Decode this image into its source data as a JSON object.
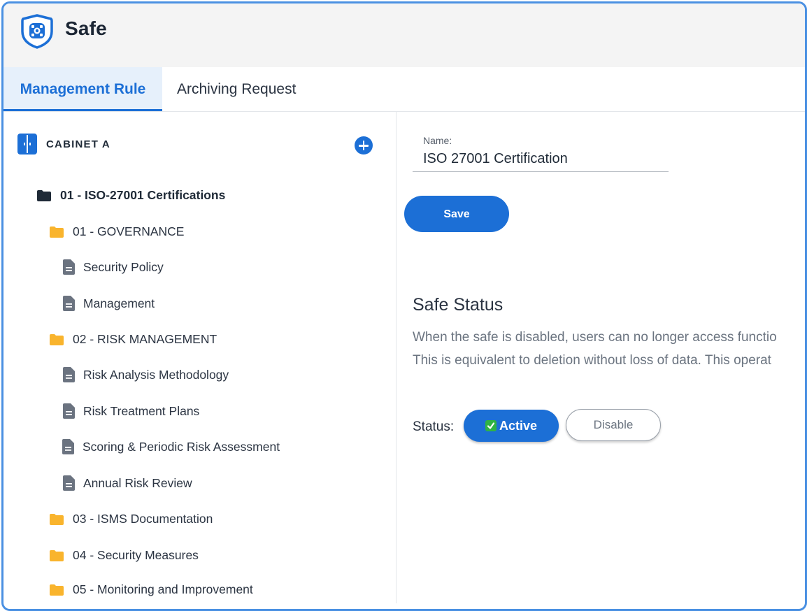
{
  "app": {
    "title": "Safe",
    "logo_icon": "shield-icon",
    "accent": "#1c6fd6"
  },
  "tabs": [
    {
      "label": "Management Rule",
      "active": true
    },
    {
      "label": "Archiving Request",
      "active": false
    }
  ],
  "cabinet": {
    "label": "CABINET A",
    "icon": "cabinet-icon",
    "add_icon": "plus-circle-icon"
  },
  "tree": {
    "root": {
      "label": "01 - ISO-27001 Certifications",
      "icon": "folder-dark-icon"
    },
    "items": [
      {
        "label": "01 - GOVERNANCE",
        "type": "folder"
      },
      {
        "label": "Security Policy",
        "type": "document"
      },
      {
        "label": "Management",
        "type": "document"
      },
      {
        "label": "02 - RISK MANAGEMENT",
        "type": "folder"
      },
      {
        "label": "Risk Analysis Methodology",
        "type": "document"
      },
      {
        "label": "Risk Treatment Plans",
        "type": "document"
      },
      {
        "label": "Scoring & Periodic Risk Assessment",
        "type": "document"
      },
      {
        "label": "Annual Risk Review",
        "type": "document"
      },
      {
        "label": "03 - ISMS Documentation",
        "type": "folder"
      },
      {
        "label": "04 - Security Measures",
        "type": "folder"
      },
      {
        "label": "05 - Monitoring and Improvement",
        "type": "folder"
      }
    ]
  },
  "form": {
    "name_caption": "Name:",
    "name_value": "ISO 27001 Certification",
    "save_label": "Save"
  },
  "status_section": {
    "title": "Safe Status",
    "description_line1": "When the safe is disabled, users can no longer access functio",
    "description_line2": "This is equivalent to deletion without loss of data. This operat",
    "status_label": "Status:",
    "active_label": "Active",
    "disable_label": "Disable"
  }
}
